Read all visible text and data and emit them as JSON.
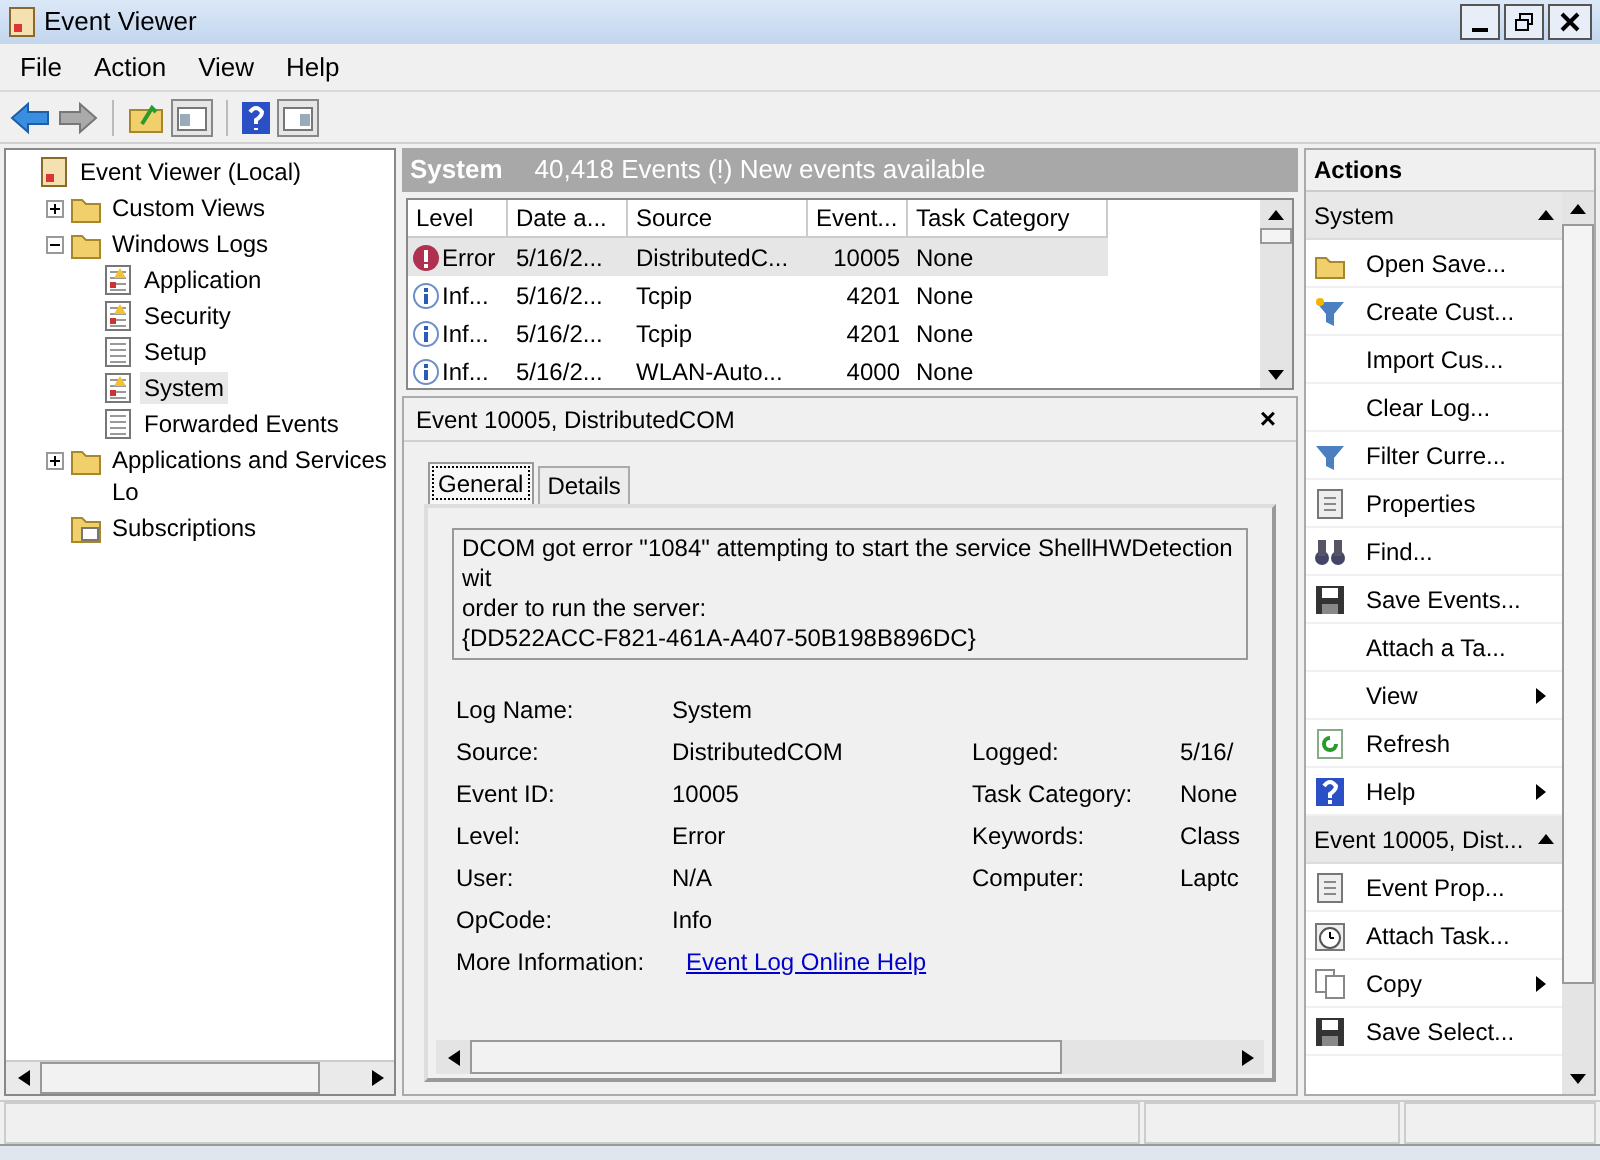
{
  "window": {
    "title": "Event Viewer"
  },
  "menu": [
    "File",
    "Action",
    "View",
    "Help"
  ],
  "tree": [
    {
      "label": "Event Viewer (Local)",
      "kind": "root",
      "selected": false,
      "children": [
        {
          "label": "Custom Views",
          "kind": "folder",
          "expanded": false,
          "selected": false
        },
        {
          "label": "Windows Logs",
          "kind": "folder",
          "expanded": true,
          "selected": false,
          "children": [
            {
              "label": "Application",
              "kind": "log",
              "selected": false
            },
            {
              "label": "Security",
              "kind": "log",
              "selected": false
            },
            {
              "label": "Setup",
              "kind": "plain-log",
              "selected": false
            },
            {
              "label": "System",
              "kind": "log",
              "selected": true
            },
            {
              "label": "Forwarded Events",
              "kind": "plain-log",
              "selected": false
            }
          ]
        },
        {
          "label": "Applications and Services Lo",
          "kind": "folder",
          "expanded": false,
          "selected": false
        },
        {
          "label": "Subscriptions",
          "kind": "subscriptions",
          "selected": false
        }
      ]
    }
  ],
  "log_header": {
    "title": "System",
    "summary": "40,418 Events (!) New events available"
  },
  "table": {
    "columns": [
      "Level",
      "Date a...",
      "Source",
      "Event...",
      "Task Category"
    ],
    "rows": [
      {
        "kind": "error",
        "level": "Error",
        "date": "5/16/2...",
        "source": "DistributedC...",
        "event_id": "10005",
        "task_category": "None",
        "selected": true
      },
      {
        "kind": "info",
        "level": "Inf...",
        "date": "5/16/2...",
        "source": "Tcpip",
        "event_id": "4201",
        "task_category": "None",
        "selected": false
      },
      {
        "kind": "info",
        "level": "Inf...",
        "date": "5/16/2...",
        "source": "Tcpip",
        "event_id": "4201",
        "task_category": "None",
        "selected": false
      },
      {
        "kind": "info",
        "level": "Inf...",
        "date": "5/16/2...",
        "source": "WLAN-Auto...",
        "event_id": "4000",
        "task_category": "None",
        "selected": false
      }
    ]
  },
  "event_detail": {
    "title": "Event 10005, DistributedCOM",
    "close": "×",
    "tabs": [
      {
        "label": "General",
        "selected": true
      },
      {
        "label": "Details",
        "selected": false
      }
    ],
    "description": [
      "DCOM got error \"1084\" attempting to start the service ShellHWDetection wit",
      "order to run the server:",
      "{DD522ACC-F821-461A-A407-50B198B896DC}"
    ],
    "fields": [
      {
        "label": "Log Name:",
        "value": "System"
      },
      {
        "label": "Source:",
        "value": "DistributedCOM",
        "right_label": "Logged:",
        "right_value": "5/16/"
      },
      {
        "label": "Event ID:",
        "value": "10005",
        "right_label": "Task Category:",
        "right_value": "None"
      },
      {
        "label": "Level:",
        "value": "Error",
        "right_label": "Keywords:",
        "right_value": "Class"
      },
      {
        "label": "User:",
        "value": "N/A",
        "right_label": "Computer:",
        "right_value": "Laptc"
      },
      {
        "label": "OpCode:",
        "value": "Info"
      }
    ],
    "more_info": {
      "label": "More Information:",
      "link": "Event Log Online Help"
    }
  },
  "actions": {
    "title": "Actions",
    "sections": [
      {
        "title": "System",
        "expanded": true,
        "items": [
          {
            "label": "Open Save...",
            "kind": "folder"
          },
          {
            "label": "Create Cust...",
            "kind": "filter-new"
          },
          {
            "label": "Import Cus..."
          },
          {
            "label": "Clear Log..."
          },
          {
            "label": "Filter Curre...",
            "kind": "filter"
          },
          {
            "label": "Properties",
            "kind": "properties"
          },
          {
            "label": "Find...",
            "kind": "binoculars"
          },
          {
            "label": "Save Events...",
            "kind": "disk"
          },
          {
            "label": "Attach a Ta..."
          },
          {
            "label": "View",
            "submenu": true
          },
          {
            "label": "Refresh",
            "kind": "refresh"
          },
          {
            "label": "Help",
            "kind": "help",
            "submenu": true
          }
        ]
      },
      {
        "title": "Event 10005, Dist...",
        "expanded": true,
        "items": [
          {
            "label": "Event Prop...",
            "kind": "properties"
          },
          {
            "label": "Attach Task...",
            "kind": "clock"
          },
          {
            "label": "Copy",
            "kind": "copy",
            "submenu": true
          },
          {
            "label": "Save Select...",
            "kind": "disk"
          }
        ]
      }
    ]
  }
}
